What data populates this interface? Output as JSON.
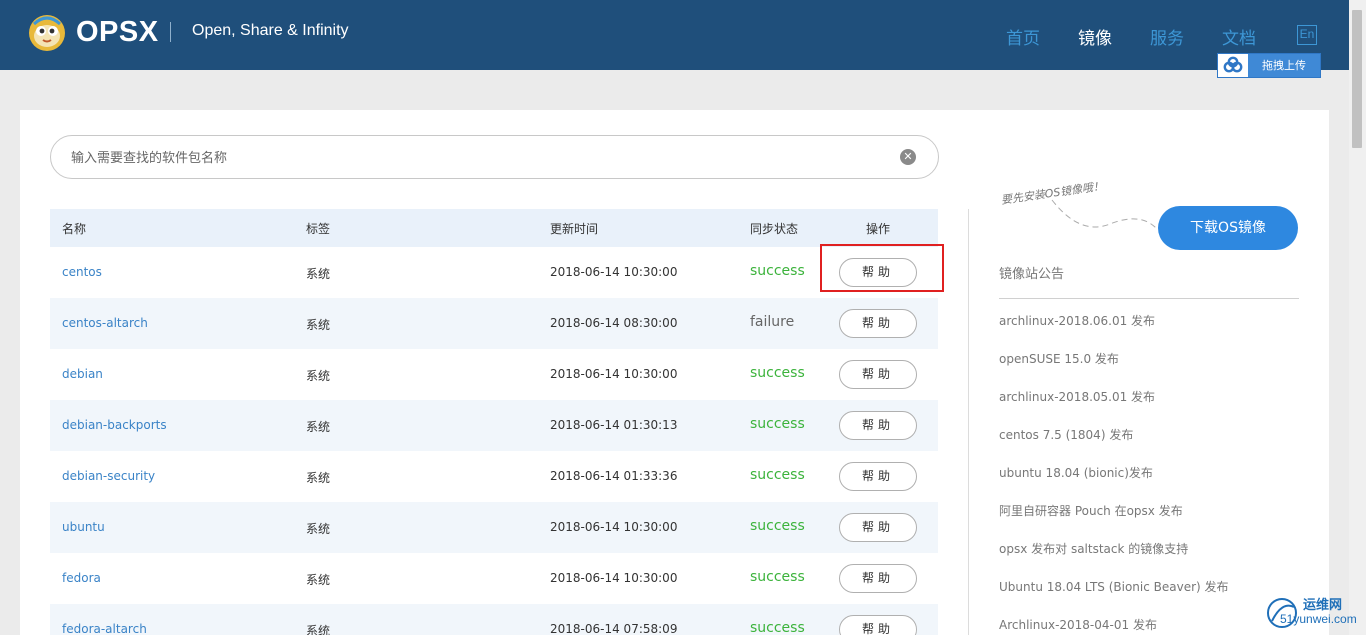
{
  "header": {
    "brand": "OPSX",
    "tagline": "Open, Share & Infinity",
    "nav": [
      "首页",
      "镜像",
      "服务",
      "文档"
    ],
    "active_nav": "镜像",
    "lang": "En",
    "upload_label": "拖拽上传"
  },
  "search": {
    "placeholder": "输入需要查找的软件包名称",
    "clear_glyph": "✕"
  },
  "table": {
    "headers": [
      "名称",
      "标签",
      "更新时间",
      "同步状态",
      "操作"
    ],
    "rows": [
      {
        "name": "centos",
        "tag": "系统",
        "time": "2018-06-14 10:30:00",
        "status": "success",
        "action": "帮助"
      },
      {
        "name": "centos-altarch",
        "tag": "系统",
        "time": "2018-06-14 08:30:00",
        "status": "failure",
        "action": "帮助"
      },
      {
        "name": "debian",
        "tag": "系统",
        "time": "2018-06-14 10:30:00",
        "status": "success",
        "action": "帮助"
      },
      {
        "name": "debian-backports",
        "tag": "系统",
        "time": "2018-06-14 01:30:13",
        "status": "success",
        "action": "帮助"
      },
      {
        "name": "debian-security",
        "tag": "系统",
        "time": "2018-06-14 01:33:36",
        "status": "success",
        "action": "帮助"
      },
      {
        "name": "ubuntu",
        "tag": "系统",
        "time": "2018-06-14 10:30:00",
        "status": "success",
        "action": "帮助"
      },
      {
        "name": "fedora",
        "tag": "系统",
        "time": "2018-06-14 10:30:00",
        "status": "success",
        "action": "帮助"
      },
      {
        "name": "fedora-altarch",
        "tag": "系统",
        "time": "2018-06-14 07:58:09",
        "status": "success",
        "action": "帮助"
      }
    ]
  },
  "sidebar": {
    "hint": "要先安装OS镜像哦！",
    "download_label": "下载OS镜像",
    "notice_title": "镜像站公告",
    "notices": [
      "archlinux-2018.06.01 发布",
      "openSUSE 15.0 发布",
      "archlinux-2018.05.01 发布",
      "centos 7.5 (1804) 发布",
      "ubuntu 18.04 (bionic)发布",
      "阿里自研容器 Pouch 在opsx 发布",
      "opsx 发布对 saltstack 的镜像支持",
      "Ubuntu 18.04 LTS (Bionic Beaver) 发布",
      "Archlinux-2018-04-01 发布"
    ]
  },
  "watermark": {
    "line1": "运维网",
    "line2": "51yunwei.com"
  },
  "colors": {
    "topbar": "#1f4f7b",
    "nav_link": "#3d97d6",
    "success": "#3cb33c",
    "link": "#3a83c7",
    "primary_button": "#2e88e0",
    "highlight_box": "#e02020"
  }
}
